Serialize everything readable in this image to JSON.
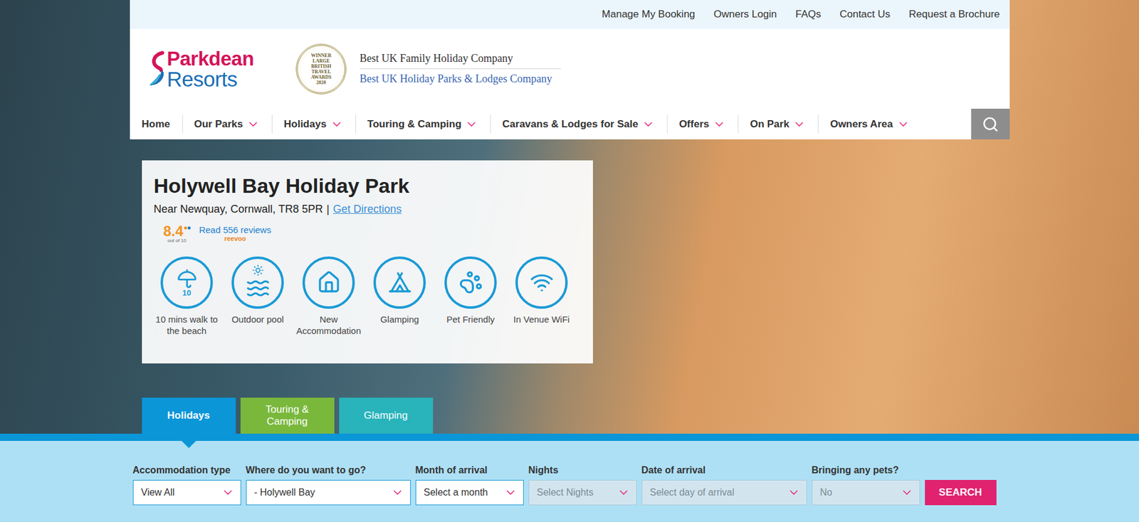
{
  "utility_links": [
    "Manage My Booking",
    "Owners Login",
    "FAQs",
    "Contact Us",
    "Request a Brochure"
  ],
  "logo": {
    "line1": "Parkdean",
    "line2": "Resorts"
  },
  "award": {
    "badge": [
      "WINNER",
      "LARGE",
      "BRITISH",
      "TRAVEL",
      "AWARDS",
      "2020"
    ],
    "titles": [
      "Best UK Family Holiday Company",
      "Best UK Holiday Parks & Lodges Company"
    ]
  },
  "nav": [
    {
      "label": "Home",
      "has_menu": false
    },
    {
      "label": "Our Parks",
      "has_menu": true
    },
    {
      "label": "Holidays",
      "has_menu": true
    },
    {
      "label": "Touring & Camping",
      "has_menu": true
    },
    {
      "label": "Caravans & Lodges for Sale",
      "has_menu": true
    },
    {
      "label": "Offers",
      "has_menu": true
    },
    {
      "label": "On Park",
      "has_menu": true
    },
    {
      "label": "Owners Area",
      "has_menu": true
    }
  ],
  "park": {
    "title": "Holywell Bay Holiday Park",
    "address": "Near Newquay, Cornwall, TR8 5PR",
    "separator": "|",
    "directions": "Get Directions",
    "rating": {
      "score": "8.4",
      "scale": "out of 10",
      "reviews": "Read 556 reviews",
      "provider": "reevoo"
    }
  },
  "features": [
    {
      "label": "10 mins walk to the beach",
      "kind": "beach",
      "icon_text": "10"
    },
    {
      "label": "Outdoor pool",
      "kind": "pool"
    },
    {
      "label": "New Accommodation",
      "kind": "accommodation"
    },
    {
      "label": "Glamping",
      "kind": "glamping"
    },
    {
      "label": "Pet Friendly",
      "kind": "pet"
    },
    {
      "label": "In Venue WiFi",
      "kind": "wifi"
    }
  ],
  "tabs": [
    {
      "label": "Holidays",
      "selected": true,
      "color": "#0b96d8"
    },
    {
      "label": "Touring & Camping",
      "selected": false,
      "color": "#7ab83c"
    },
    {
      "label": "Glamping",
      "selected": false,
      "color": "#29b3bb"
    }
  ],
  "search": {
    "fields": [
      {
        "label": "Accommodation type",
        "value": "View All",
        "disabled": false
      },
      {
        "label": "Where do you want to go?",
        "value": "- Holywell Bay",
        "disabled": false
      },
      {
        "label": "Month of arrival",
        "value": "Select a month",
        "disabled": false
      },
      {
        "label": "Nights",
        "value": "Select Nights",
        "disabled": true
      },
      {
        "label": "Date of arrival",
        "value": "Select day of arrival",
        "disabled": true
      },
      {
        "label": "Bringing any pets?",
        "value": "No",
        "disabled": true
      }
    ],
    "button": "SEARCH"
  }
}
